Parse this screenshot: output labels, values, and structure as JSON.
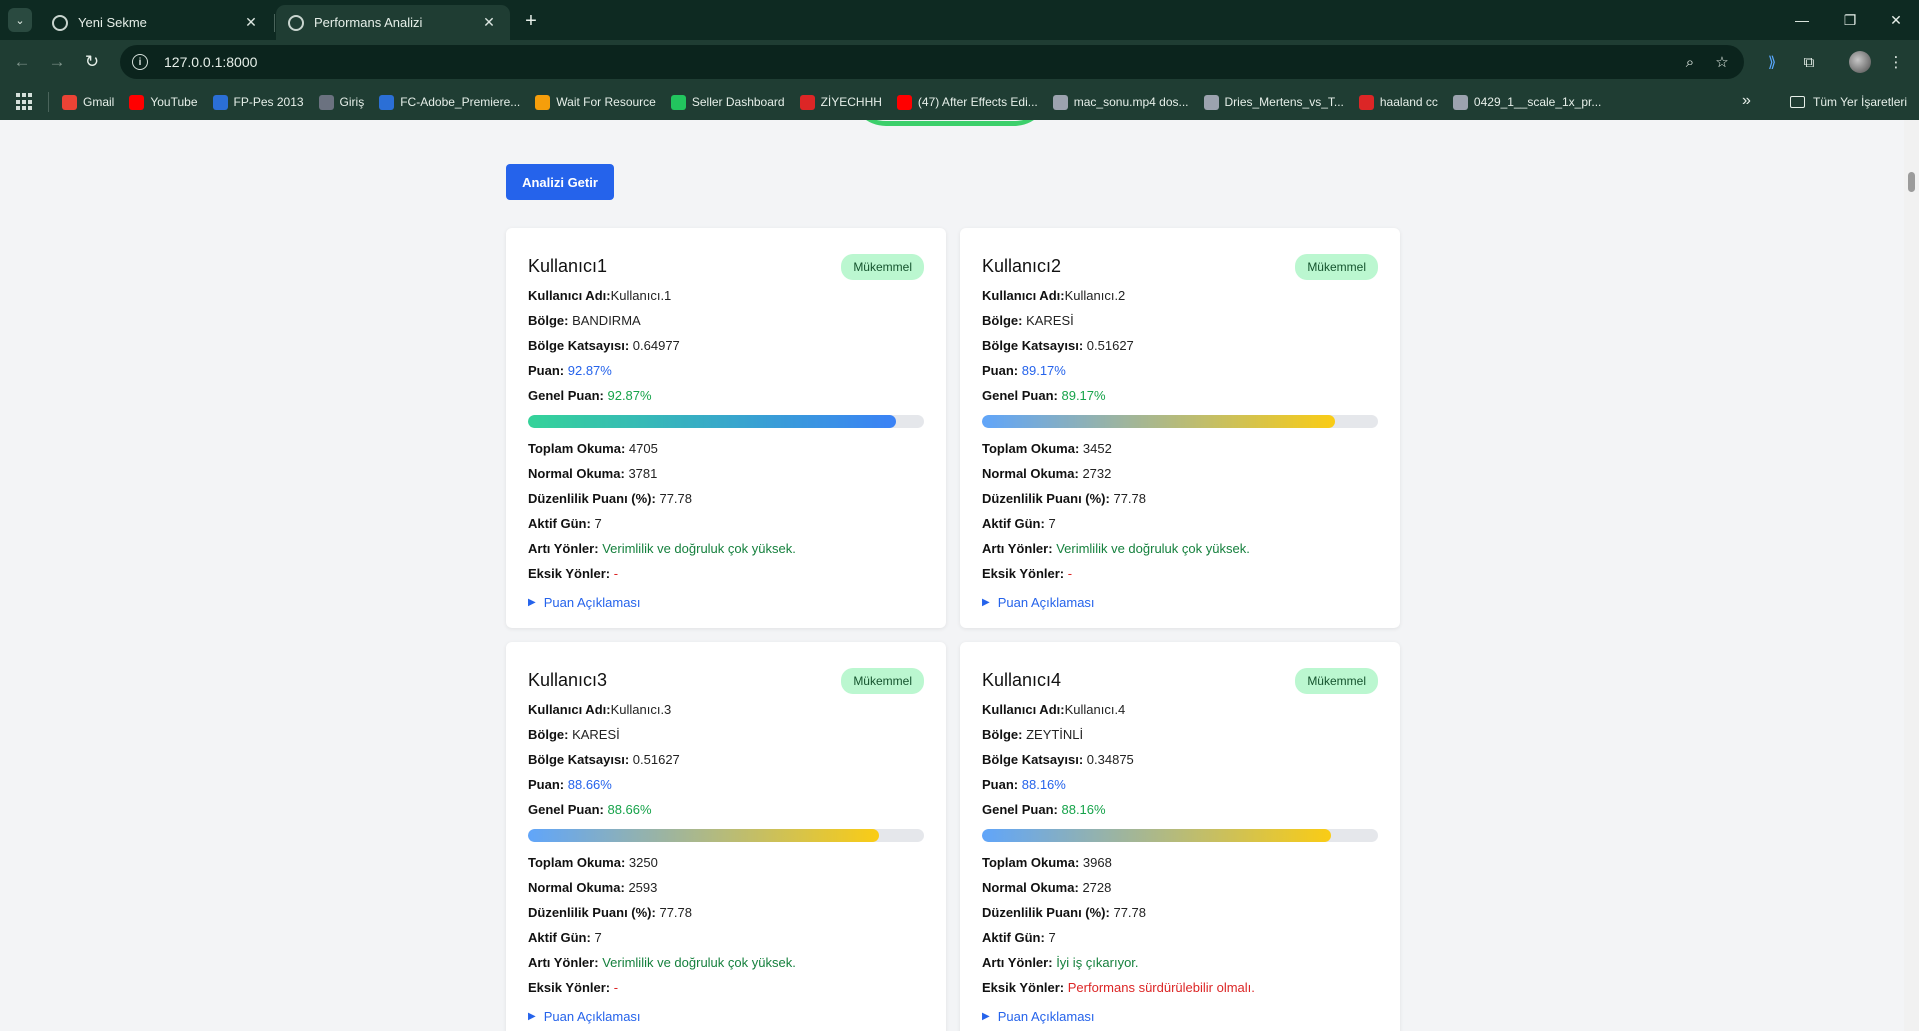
{
  "browser": {
    "tabs": [
      {
        "title": "Yeni Sekme",
        "active": false
      },
      {
        "title": "Performans Analizi",
        "active": true
      }
    ],
    "url": "127.0.0.1:8000",
    "bookmarks": [
      {
        "label": "Gmail",
        "icon": "gmail-icon",
        "color": "#ea4335"
      },
      {
        "label": "YouTube",
        "icon": "youtube-icon",
        "color": "#ff0000"
      },
      {
        "label": "FP-Pes 2013",
        "icon": "pes-icon",
        "color": "#2b6fd6"
      },
      {
        "label": "Giriş",
        "icon": "login-icon",
        "color": "#6b7280"
      },
      {
        "label": "FC-Adobe_Premiere...",
        "icon": "fc-icon",
        "color": "#2b6fd6"
      },
      {
        "label": "Wait For Resource",
        "icon": "g-icon",
        "color": "#f59e0b"
      },
      {
        "label": "Seller Dashboard",
        "icon": "seller-icon",
        "color": "#22c55e"
      },
      {
        "label": "ZİYECHHH",
        "icon": "m-icon",
        "color": "#dc2626"
      },
      {
        "label": "(47) After Effects Edi...",
        "icon": "youtube-icon",
        "color": "#ff0000"
      },
      {
        "label": "mac_sonu.mp4 dos...",
        "icon": "drive-icon",
        "color": "#9ca3af"
      },
      {
        "label": "Dries_Mertens_vs_T...",
        "icon": "drive-icon",
        "color": "#9ca3af"
      },
      {
        "label": "haaland cc",
        "icon": "m-icon",
        "color": "#dc2626"
      },
      {
        "label": "0429_1__scale_1x_pr...",
        "icon": "drive-icon",
        "color": "#9ca3af"
      }
    ],
    "all_bookmarks": "Tüm Yer İşaretleri"
  },
  "page": {
    "fetch_button": "Analizi Getir",
    "labels": {
      "username": "Kullanıcı Adı:",
      "region": "Bölge:",
      "region_coef": "Bölge Katsayısı:",
      "score": "Puan:",
      "general_score": "Genel Puan:",
      "total_reads": "Toplam Okuma:",
      "normal_reads": "Normal Okuma:",
      "regularity": "Düzenlilik Puanı (%):",
      "active_days": "Aktif Gün:",
      "pros": "Artı Yönler:",
      "cons": "Eksik Yönler:",
      "explain": "Puan Açıklaması"
    },
    "cards": [
      {
        "title": "Kullanıcı1",
        "badge": "Mükemmel",
        "username": "Kullanıcı.1",
        "region": "BANDIRMA",
        "region_coef": "0.64977",
        "score": "92.87%",
        "general_score": "92.87%",
        "progress": 0.9287,
        "bar_style": "grad-green",
        "total_reads": "4705",
        "normal_reads": "3781",
        "regularity": "77.78",
        "active_days": "7",
        "pros": "Verimlilik ve doğruluk çok yüksek.",
        "cons": "-"
      },
      {
        "title": "Kullanıcı2",
        "badge": "Mükemmel",
        "username": "Kullanıcı.2",
        "region": "KARESİ",
        "region_coef": "0.51627",
        "score": "89.17%",
        "general_score": "89.17%",
        "progress": 0.8917,
        "bar_style": "grad-gold",
        "total_reads": "3452",
        "normal_reads": "2732",
        "regularity": "77.78",
        "active_days": "7",
        "pros": "Verimlilik ve doğruluk çok yüksek.",
        "cons": "-"
      },
      {
        "title": "Kullanıcı3",
        "badge": "Mükemmel",
        "username": "Kullanıcı.3",
        "region": "KARESİ",
        "region_coef": "0.51627",
        "score": "88.66%",
        "general_score": "88.66%",
        "progress": 0.8866,
        "bar_style": "grad-gold",
        "total_reads": "3250",
        "normal_reads": "2593",
        "regularity": "77.78",
        "active_days": "7",
        "pros": "Verimlilik ve doğruluk çok yüksek.",
        "cons": "-"
      },
      {
        "title": "Kullanıcı4",
        "badge": "Mükemmel",
        "username": "Kullanıcı.4",
        "region": "ZEYTİNLİ",
        "region_coef": "0.34875",
        "score": "88.16%",
        "general_score": "88.16%",
        "progress": 0.8816,
        "bar_style": "grad-gold",
        "total_reads": "3968",
        "normal_reads": "2728",
        "regularity": "77.78",
        "active_days": "7",
        "pros": "İyi iş çıkarıyor.",
        "cons": "Performans sürdürülebilir olmalı."
      }
    ]
  }
}
